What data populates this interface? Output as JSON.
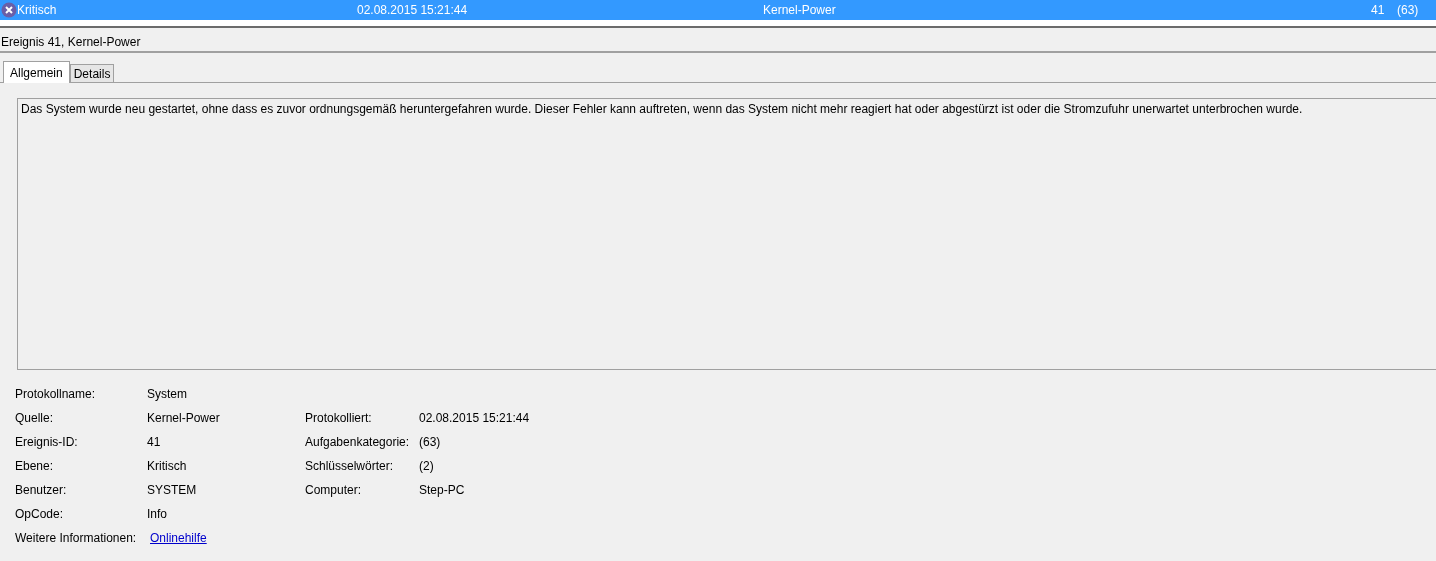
{
  "event_list": {
    "rows": [
      {
        "kind": "critical",
        "level": "Kritisch",
        "date": "02.08.2015 15:21:44",
        "source": "Kernel-Power",
        "event_id": "41",
        "task_category": "(63)",
        "selected": true
      }
    ]
  },
  "detail": {
    "title": "Ereignis 41, Kernel-Power",
    "tabs": [
      {
        "label": "Allgemein",
        "selected": true
      },
      {
        "label": "Details",
        "selected": false
      }
    ],
    "description": "Das System wurde neu gestartet, ohne dass es zuvor ordnungsgemäß heruntergefahren wurde. Dieser Fehler kann auftreten, wenn das System nicht mehr reagiert hat oder abgestürzt ist oder die Stromzufuhr unerwartet unterbrochen wurde.",
    "properties": [
      {
        "left": {
          "label": "Protokollname:",
          "value": "System",
          "kind": "text"
        }
      },
      {
        "left": {
          "label": "Quelle:",
          "value": "Kernel-Power",
          "kind": "text"
        },
        "right": {
          "label": "Protokolliert:",
          "value": "02.08.2015 15:21:44",
          "kind": "text"
        }
      },
      {
        "left": {
          "label": "Ereignis-ID:",
          "value": "41",
          "kind": "text"
        },
        "right": {
          "label": "Aufgabenkategorie:",
          "value": "(63)",
          "kind": "text"
        }
      },
      {
        "left": {
          "label": "Ebene:",
          "value": "Kritisch",
          "kind": "text"
        },
        "right": {
          "label": "Schlüsselwörter:",
          "value": "(2)",
          "kind": "text"
        }
      },
      {
        "left": {
          "label": "Benutzer:",
          "value": "SYSTEM",
          "kind": "text"
        },
        "right": {
          "label": "Computer:",
          "value": "Step-PC",
          "kind": "text"
        }
      },
      {
        "left": {
          "label": "OpCode:",
          "value": "Info",
          "kind": "text"
        }
      },
      {
        "left": {
          "label": "Weitere Informationen:",
          "value": "Onlinehilfe",
          "kind": "link"
        }
      }
    ]
  }
}
